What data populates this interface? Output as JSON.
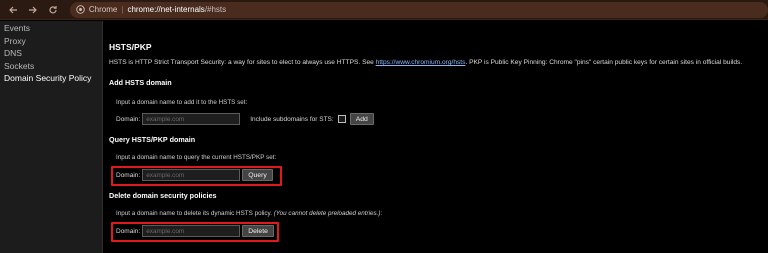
{
  "browser": {
    "tab_label": "Chrome",
    "url_host": "chrome://net-internals",
    "url_rest": "/#hsts"
  },
  "sidebar": {
    "items": [
      {
        "label": "Events"
      },
      {
        "label": "Proxy"
      },
      {
        "label": "DNS"
      },
      {
        "label": "Sockets"
      },
      {
        "label": "Domain Security Policy"
      }
    ]
  },
  "main": {
    "title": "HSTS/PKP",
    "desc_before": "HSTS is HTTP Strict Transport Security: a way for sites to elect to always use HTTPS. See ",
    "desc_link": "https://www.chromium.org/hsts",
    "desc_after": ". PKP is Public Key Pinning: Chrome \"pins\" certain public keys for certain sites in official builds.",
    "add": {
      "heading": "Add HSTS domain",
      "hint": "Input a domain name to add it to the HSTS set:",
      "domain_label": "Domain:",
      "placeholder": "example.com",
      "include_label": "Include subdomains for STS:",
      "button": "Add"
    },
    "query": {
      "heading": "Query HSTS/PKP domain",
      "hint": "Input a domain name to query the current HSTS/PKP set:",
      "domain_label": "Domain:",
      "placeholder": "example.com",
      "button": "Query"
    },
    "delete": {
      "heading": "Delete domain security policies",
      "hint_plain": "Input a domain name to delete its dynamic HSTS policy. ",
      "hint_italic": "(You cannot delete preloaded entries.)",
      "hint_end": ":",
      "domain_label": "Domain:",
      "placeholder": "example.com",
      "button": "Delete"
    }
  },
  "colors": {
    "highlight": "#e0191f",
    "link": "#8ab4f8",
    "toolbar": "#2b1a12"
  }
}
